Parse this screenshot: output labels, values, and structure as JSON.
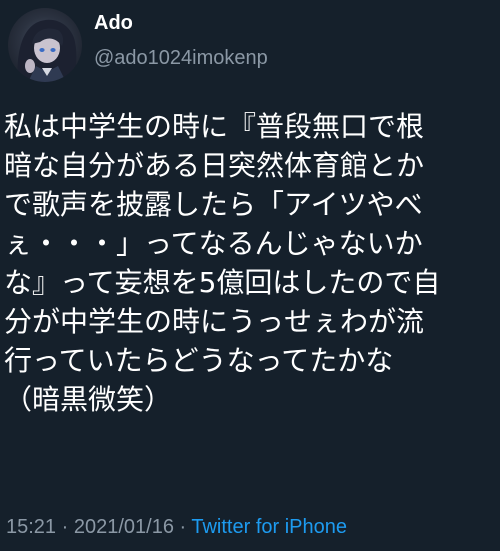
{
  "author": {
    "display_name": "Ado",
    "handle": "@ado1024imokenp",
    "avatar_icon": "profile-avatar"
  },
  "tweet": {
    "lines": [
      "私は中学生の時に『普段無口で根",
      "暗な自分がある日突然体育館とか",
      "で歌声を披露したら「アイツやべ",
      "ぇ・・・」ってなるんじゃないか",
      "な』って妄想を5億回はしたので自",
      "分が中学生の時にうっせぇわが流",
      "行っていたらどうなってたかな",
      "（暗黒微笑）"
    ]
  },
  "meta": {
    "time": "15:21",
    "separator_1": " · ",
    "date": "2021/01/16",
    "separator_2": " · ",
    "source": "Twitter for iPhone"
  },
  "colors": {
    "background": "#15202b",
    "text": "#ffffff",
    "secondary_text": "#8b98a5",
    "link": "#1d9bf0"
  }
}
